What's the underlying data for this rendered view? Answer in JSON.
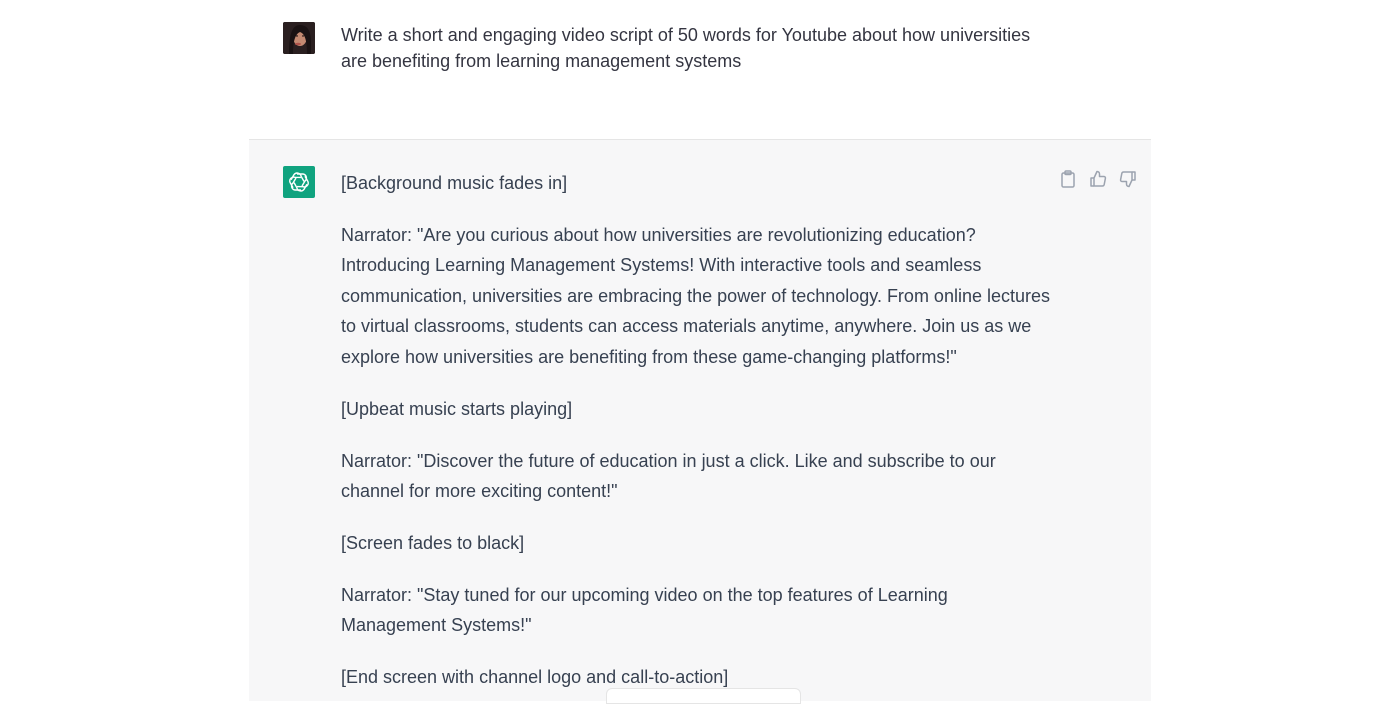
{
  "conversation": {
    "user_message": {
      "avatar_icon": "user-avatar-photo",
      "text": "Write a short and engaging video script of 50 words for Youtube about how universities are benefiting from learning management systems"
    },
    "assistant_message": {
      "avatar_icon": "openai-logo-icon",
      "avatar_color": "#10a37f",
      "paragraphs": [
        "[Background music fades in]",
        "Narrator: \"Are you curious about how universities are revolutionizing education? Introducing Learning Management Systems! With interactive tools and seamless communication, universities are embracing the power of technology. From online lectures to virtual classrooms, students can access materials anytime, anywhere. Join us as we explore how universities are benefiting from these game-changing platforms!\"",
        "[Upbeat music starts playing]",
        "Narrator: \"Discover the future of education in just a click. Like and subscribe to our channel for more exciting content!\"",
        "[Screen fades to black]",
        "Narrator: \"Stay tuned for our upcoming video on the top features of Learning Management Systems!\"",
        "[End screen with channel logo and call-to-action]"
      ],
      "actions": [
        "clipboard-icon",
        "thumbs-up-icon",
        "thumbs-down-icon"
      ]
    }
  }
}
